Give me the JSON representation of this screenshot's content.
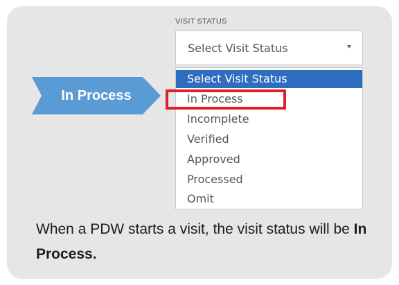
{
  "visit_status": {
    "label": "VISIT STATUS",
    "selected_value": "Select Visit Status",
    "options": [
      {
        "label": "Select Visit Status",
        "selected": true
      },
      {
        "label": "In Process",
        "selected": false,
        "highlighted": true
      },
      {
        "label": "Incomplete",
        "selected": false
      },
      {
        "label": "Verified",
        "selected": false
      },
      {
        "label": "Approved",
        "selected": false
      },
      {
        "label": "Processed",
        "selected": false
      },
      {
        "label": "Omit",
        "selected": false
      }
    ]
  },
  "callout": {
    "label": "In Process",
    "color": "#5b9bd5"
  },
  "caption": {
    "text_before": "When a PDW starts a visit, the visit status will be ",
    "bold_text": "In Process."
  },
  "colors": {
    "card_background": "#e6e6e7",
    "selected_option": "#2f6dc0",
    "highlight_border": "#e01f26"
  }
}
